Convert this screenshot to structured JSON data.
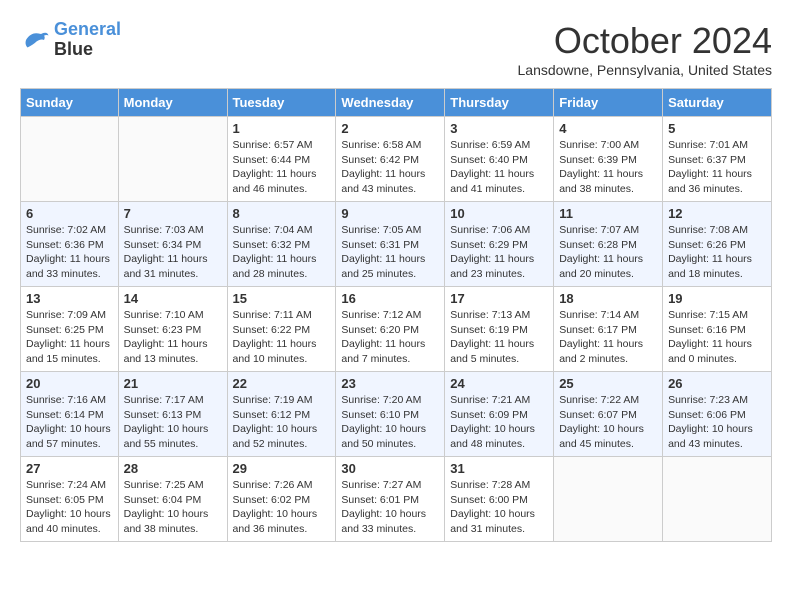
{
  "header": {
    "logo_line1": "General",
    "logo_line2": "Blue",
    "month": "October 2024",
    "location": "Lansdowne, Pennsylvania, United States"
  },
  "days_of_week": [
    "Sunday",
    "Monday",
    "Tuesday",
    "Wednesday",
    "Thursday",
    "Friday",
    "Saturday"
  ],
  "weeks": [
    [
      {
        "day": "",
        "sunrise": "",
        "sunset": "",
        "daylight": ""
      },
      {
        "day": "",
        "sunrise": "",
        "sunset": "",
        "daylight": ""
      },
      {
        "day": "1",
        "sunrise": "Sunrise: 6:57 AM",
        "sunset": "Sunset: 6:44 PM",
        "daylight": "Daylight: 11 hours and 46 minutes."
      },
      {
        "day": "2",
        "sunrise": "Sunrise: 6:58 AM",
        "sunset": "Sunset: 6:42 PM",
        "daylight": "Daylight: 11 hours and 43 minutes."
      },
      {
        "day": "3",
        "sunrise": "Sunrise: 6:59 AM",
        "sunset": "Sunset: 6:40 PM",
        "daylight": "Daylight: 11 hours and 41 minutes."
      },
      {
        "day": "4",
        "sunrise": "Sunrise: 7:00 AM",
        "sunset": "Sunset: 6:39 PM",
        "daylight": "Daylight: 11 hours and 38 minutes."
      },
      {
        "day": "5",
        "sunrise": "Sunrise: 7:01 AM",
        "sunset": "Sunset: 6:37 PM",
        "daylight": "Daylight: 11 hours and 36 minutes."
      }
    ],
    [
      {
        "day": "6",
        "sunrise": "Sunrise: 7:02 AM",
        "sunset": "Sunset: 6:36 PM",
        "daylight": "Daylight: 11 hours and 33 minutes."
      },
      {
        "day": "7",
        "sunrise": "Sunrise: 7:03 AM",
        "sunset": "Sunset: 6:34 PM",
        "daylight": "Daylight: 11 hours and 31 minutes."
      },
      {
        "day": "8",
        "sunrise": "Sunrise: 7:04 AM",
        "sunset": "Sunset: 6:32 PM",
        "daylight": "Daylight: 11 hours and 28 minutes."
      },
      {
        "day": "9",
        "sunrise": "Sunrise: 7:05 AM",
        "sunset": "Sunset: 6:31 PM",
        "daylight": "Daylight: 11 hours and 25 minutes."
      },
      {
        "day": "10",
        "sunrise": "Sunrise: 7:06 AM",
        "sunset": "Sunset: 6:29 PM",
        "daylight": "Daylight: 11 hours and 23 minutes."
      },
      {
        "day": "11",
        "sunrise": "Sunrise: 7:07 AM",
        "sunset": "Sunset: 6:28 PM",
        "daylight": "Daylight: 11 hours and 20 minutes."
      },
      {
        "day": "12",
        "sunrise": "Sunrise: 7:08 AM",
        "sunset": "Sunset: 6:26 PM",
        "daylight": "Daylight: 11 hours and 18 minutes."
      }
    ],
    [
      {
        "day": "13",
        "sunrise": "Sunrise: 7:09 AM",
        "sunset": "Sunset: 6:25 PM",
        "daylight": "Daylight: 11 hours and 15 minutes."
      },
      {
        "day": "14",
        "sunrise": "Sunrise: 7:10 AM",
        "sunset": "Sunset: 6:23 PM",
        "daylight": "Daylight: 11 hours and 13 minutes."
      },
      {
        "day": "15",
        "sunrise": "Sunrise: 7:11 AM",
        "sunset": "Sunset: 6:22 PM",
        "daylight": "Daylight: 11 hours and 10 minutes."
      },
      {
        "day": "16",
        "sunrise": "Sunrise: 7:12 AM",
        "sunset": "Sunset: 6:20 PM",
        "daylight": "Daylight: 11 hours and 7 minutes."
      },
      {
        "day": "17",
        "sunrise": "Sunrise: 7:13 AM",
        "sunset": "Sunset: 6:19 PM",
        "daylight": "Daylight: 11 hours and 5 minutes."
      },
      {
        "day": "18",
        "sunrise": "Sunrise: 7:14 AM",
        "sunset": "Sunset: 6:17 PM",
        "daylight": "Daylight: 11 hours and 2 minutes."
      },
      {
        "day": "19",
        "sunrise": "Sunrise: 7:15 AM",
        "sunset": "Sunset: 6:16 PM",
        "daylight": "Daylight: 11 hours and 0 minutes."
      }
    ],
    [
      {
        "day": "20",
        "sunrise": "Sunrise: 7:16 AM",
        "sunset": "Sunset: 6:14 PM",
        "daylight": "Daylight: 10 hours and 57 minutes."
      },
      {
        "day": "21",
        "sunrise": "Sunrise: 7:17 AM",
        "sunset": "Sunset: 6:13 PM",
        "daylight": "Daylight: 10 hours and 55 minutes."
      },
      {
        "day": "22",
        "sunrise": "Sunrise: 7:19 AM",
        "sunset": "Sunset: 6:12 PM",
        "daylight": "Daylight: 10 hours and 52 minutes."
      },
      {
        "day": "23",
        "sunrise": "Sunrise: 7:20 AM",
        "sunset": "Sunset: 6:10 PM",
        "daylight": "Daylight: 10 hours and 50 minutes."
      },
      {
        "day": "24",
        "sunrise": "Sunrise: 7:21 AM",
        "sunset": "Sunset: 6:09 PM",
        "daylight": "Daylight: 10 hours and 48 minutes."
      },
      {
        "day": "25",
        "sunrise": "Sunrise: 7:22 AM",
        "sunset": "Sunset: 6:07 PM",
        "daylight": "Daylight: 10 hours and 45 minutes."
      },
      {
        "day": "26",
        "sunrise": "Sunrise: 7:23 AM",
        "sunset": "Sunset: 6:06 PM",
        "daylight": "Daylight: 10 hours and 43 minutes."
      }
    ],
    [
      {
        "day": "27",
        "sunrise": "Sunrise: 7:24 AM",
        "sunset": "Sunset: 6:05 PM",
        "daylight": "Daylight: 10 hours and 40 minutes."
      },
      {
        "day": "28",
        "sunrise": "Sunrise: 7:25 AM",
        "sunset": "Sunset: 6:04 PM",
        "daylight": "Daylight: 10 hours and 38 minutes."
      },
      {
        "day": "29",
        "sunrise": "Sunrise: 7:26 AM",
        "sunset": "Sunset: 6:02 PM",
        "daylight": "Daylight: 10 hours and 36 minutes."
      },
      {
        "day": "30",
        "sunrise": "Sunrise: 7:27 AM",
        "sunset": "Sunset: 6:01 PM",
        "daylight": "Daylight: 10 hours and 33 minutes."
      },
      {
        "day": "31",
        "sunrise": "Sunrise: 7:28 AM",
        "sunset": "Sunset: 6:00 PM",
        "daylight": "Daylight: 10 hours and 31 minutes."
      },
      {
        "day": "",
        "sunrise": "",
        "sunset": "",
        "daylight": ""
      },
      {
        "day": "",
        "sunrise": "",
        "sunset": "",
        "daylight": ""
      }
    ]
  ]
}
